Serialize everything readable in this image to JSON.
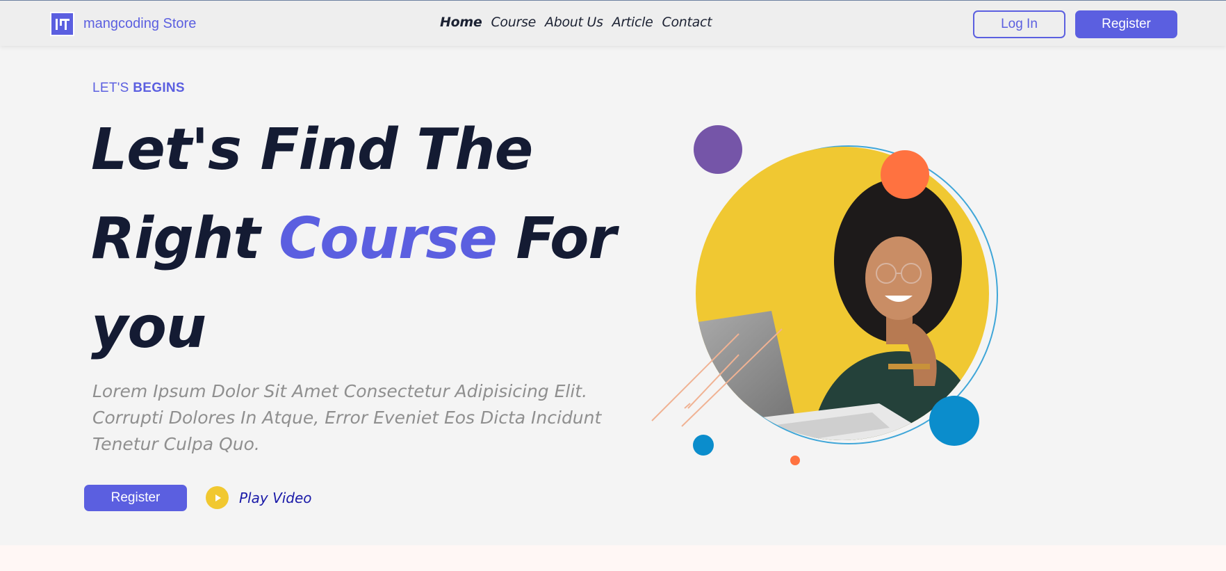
{
  "header": {
    "brand_name": "mangcoding Store",
    "logo_icon": "mangcoding-logo-icon",
    "nav": [
      {
        "label": "Home",
        "active": true
      },
      {
        "label": "Course",
        "active": false
      },
      {
        "label": "About Us",
        "active": false
      },
      {
        "label": "Article",
        "active": false
      },
      {
        "label": "Contact",
        "active": false
      }
    ],
    "login_label": "Log In",
    "register_label": "Register"
  },
  "hero": {
    "eyebrow_prefix": "LET'S",
    "eyebrow_emphasis": "BEGINS",
    "headline_line1": "Let's Find The",
    "headline_line2_start": "Right",
    "headline_accent": "Course",
    "headline_line2_end": "For",
    "headline_line3": "you",
    "lead": "Lorem Ipsum Dolor Sit Amet Consectetur Adipisicing Elit. Corrupti Dolores In Atque, Error Eveniet Eos Dicta Incidunt Tenetur Culpa Quo.",
    "register_label": "Register",
    "play_label": "Play Video",
    "play_icon": "play-icon",
    "image_subject": "student-with-laptop-illustration"
  },
  "colors": {
    "accent": "#5b5fe0",
    "heading": "#141b33",
    "play_yellow": "#f1c830",
    "circle_yellow": "#f0c832",
    "dot_purple": "#7555a8",
    "dot_orange": "#ff7240",
    "dot_blue": "#0b8dcc"
  }
}
